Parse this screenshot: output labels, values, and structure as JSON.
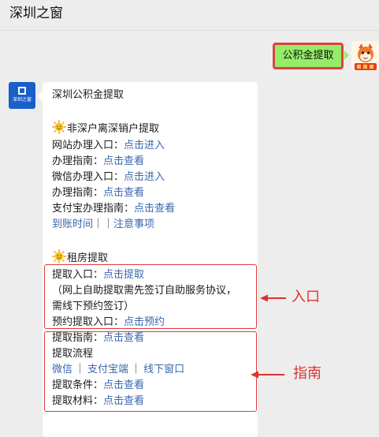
{
  "header": {
    "title": "深圳之窗"
  },
  "outgoing": {
    "text": "公积金提取"
  },
  "bot": {
    "avatar_text": "深圳之窗"
  },
  "message": {
    "title": "深圳公积金提取",
    "section1": {
      "heading": "非深户离深销户提取",
      "rows": [
        {
          "label": "网站办理入口：",
          "link": "点击进入"
        },
        {
          "label": "办理指南：",
          "link": "点击查看"
        },
        {
          "label": "微信办理入口：",
          "link": "点击进入"
        },
        {
          "label": "办理指南：",
          "link": "点击查看"
        },
        {
          "label": "支付宝办理指南：",
          "link": "点击查看"
        }
      ],
      "footer": {
        "link1": "到账时间",
        "separator": "｜｜",
        "link2": "注意事项"
      }
    },
    "section2": {
      "heading": "租房提取",
      "entry": {
        "label": "提取入口：",
        "link": "点击提取",
        "note1": "（网上自助提取需先签订自助服务协议，",
        "note2": "需线下预约签订）",
        "reserve_label": "预约提取入口：",
        "reserve_link": "点击预约"
      },
      "guide": {
        "label": "提取指南：",
        "link": "点击查看",
        "flow": "提取流程",
        "channels": [
          "微信",
          "支付宝端",
          "线下窗口"
        ],
        "channel_sep": "｜",
        "cond_label": "提取条件：",
        "cond_link": "点击查看",
        "mat_label": "提取材料：",
        "mat_link": "点击查看"
      }
    }
  },
  "annotations": {
    "entry": "入口",
    "guide": "指南"
  },
  "colors": {
    "bubble_out": "#95ec69",
    "link": "#3a67ad",
    "annotation": "#e0302f"
  }
}
